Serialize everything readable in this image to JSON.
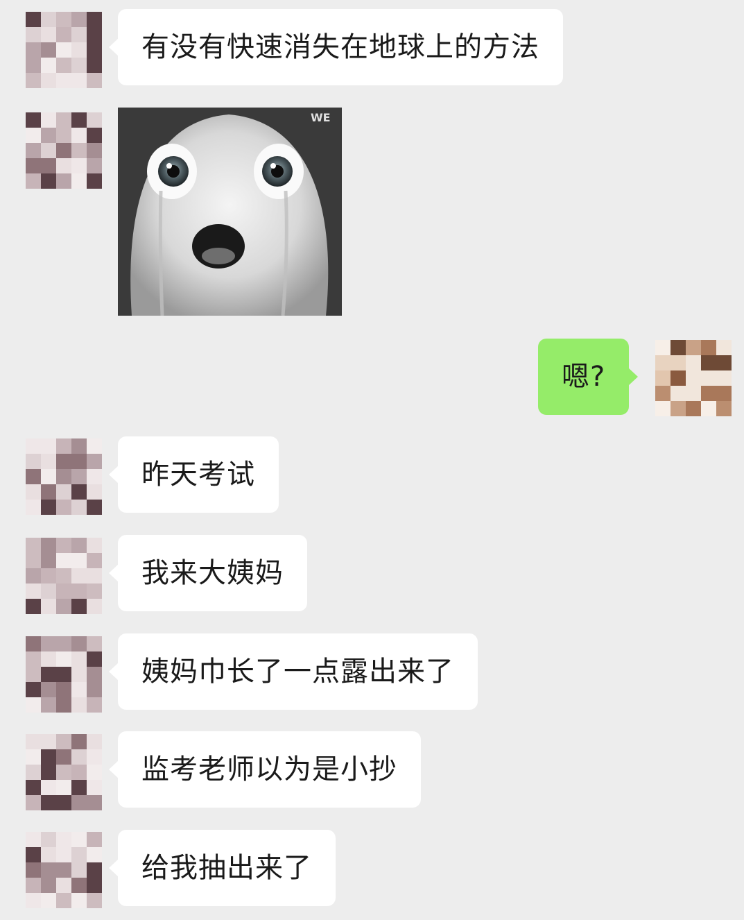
{
  "messages": [
    {
      "side": "left",
      "text": "有没有快速消失在地球上的方法"
    },
    {
      "side": "left",
      "type": "sticker",
      "sticker_label": "WE"
    },
    {
      "side": "right",
      "text": "嗯?"
    },
    {
      "side": "left",
      "text": "昨天考试"
    },
    {
      "side": "left",
      "text": "我来大姨妈"
    },
    {
      "side": "left",
      "text": "姨妈巾长了一点露出来了"
    },
    {
      "side": "left",
      "text": "监考老师以为是小抄"
    },
    {
      "side": "left",
      "text": "给我抽出来了"
    }
  ],
  "colors": {
    "background": "#ededed",
    "bubble_left": "#ffffff",
    "bubble_right": "#95ec69",
    "text": "#1a1a1a"
  }
}
